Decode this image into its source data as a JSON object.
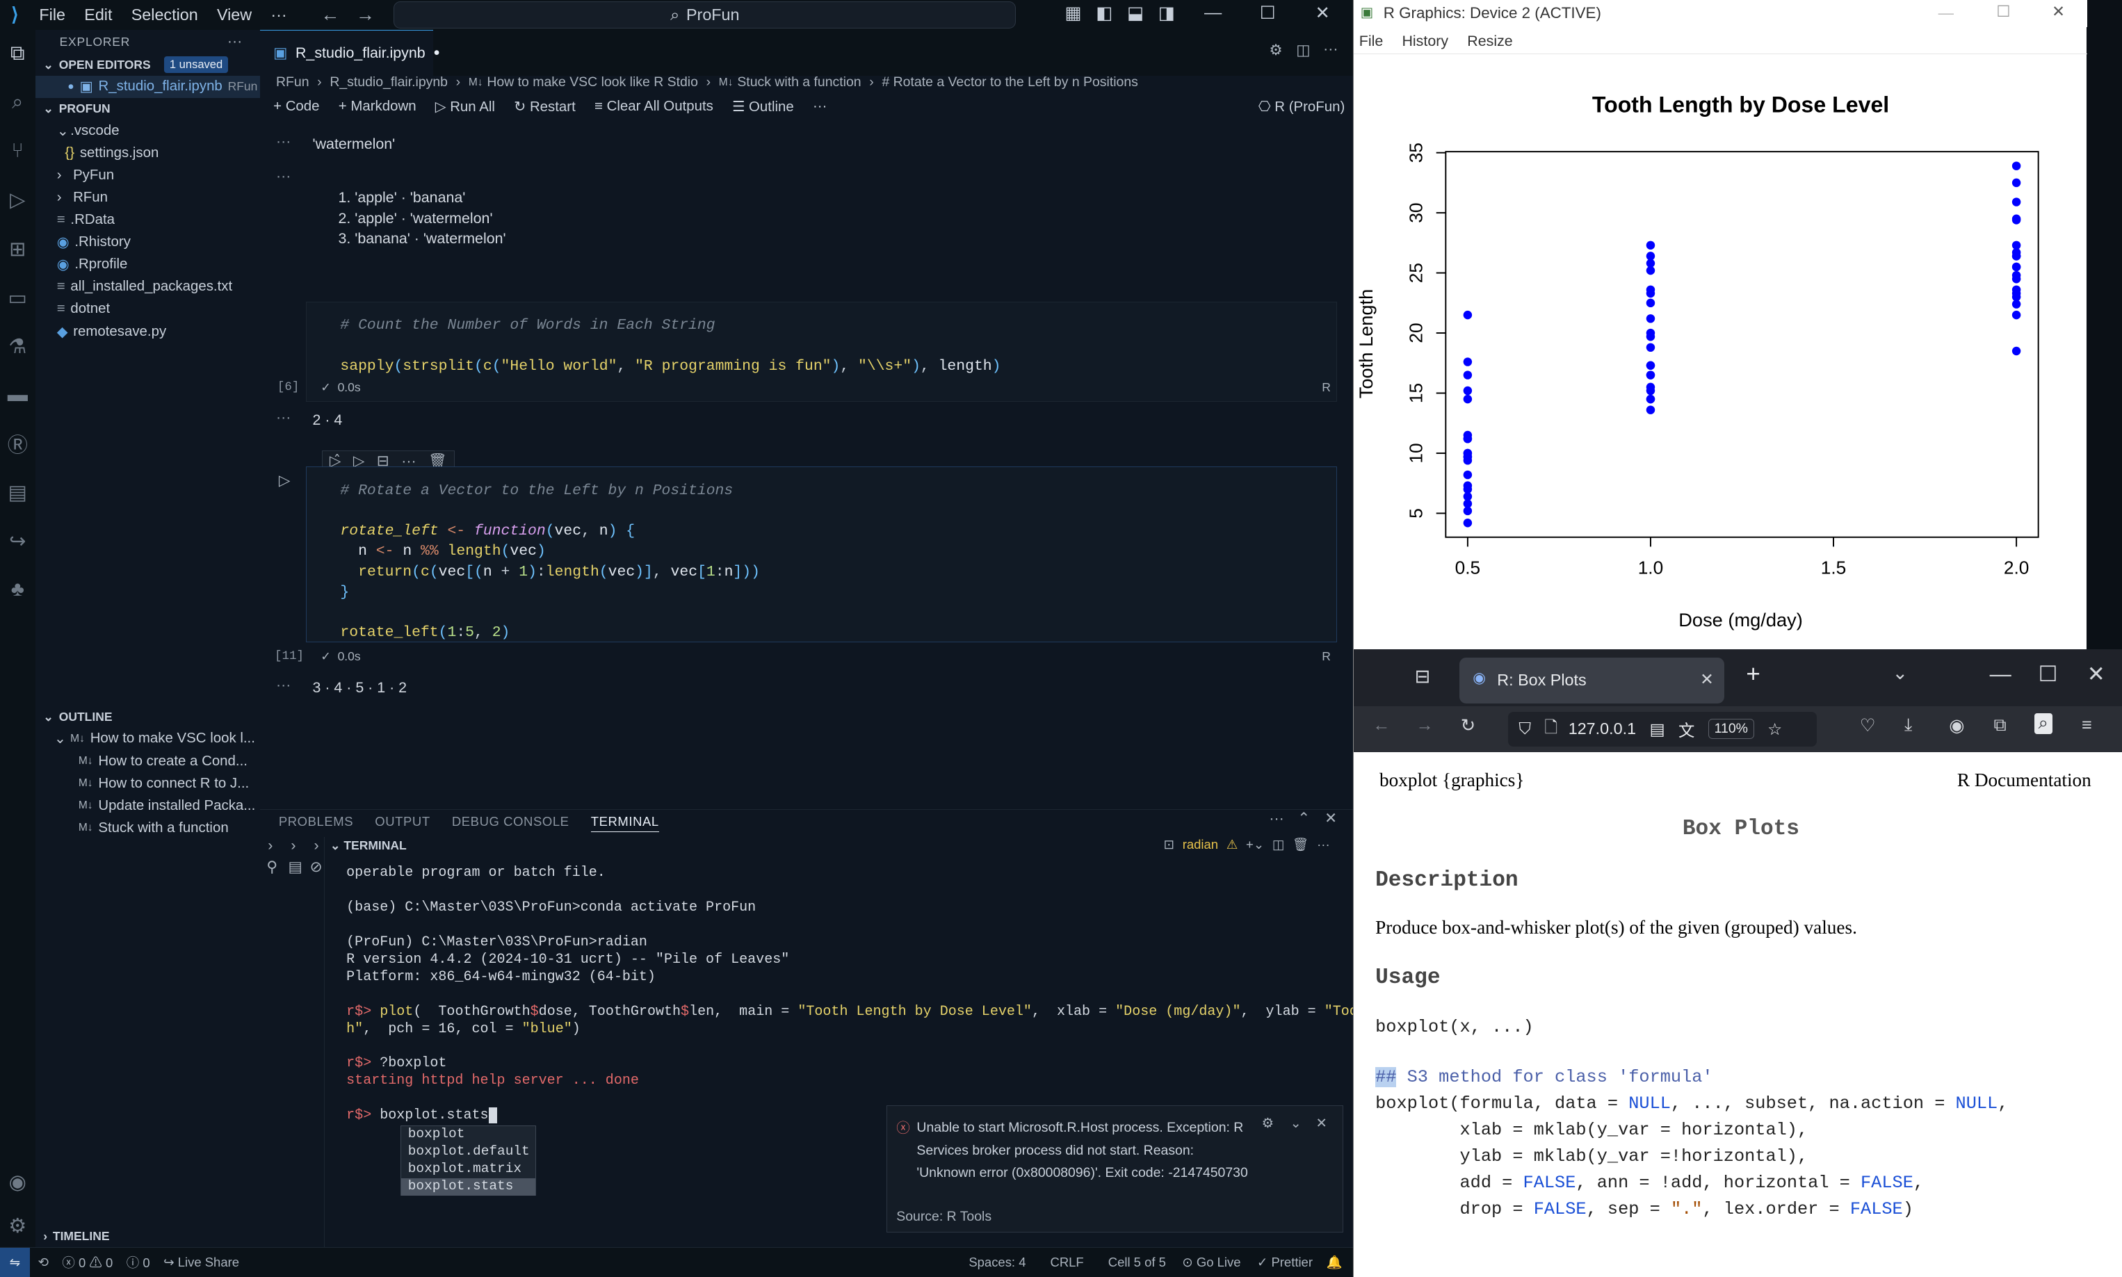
{
  "vscode": {
    "menu": [
      "File",
      "Edit",
      "Selection",
      "View",
      "···"
    ],
    "command_center": "ProFun",
    "sidebar": {
      "explorer_title": "EXPLORER",
      "open_editors": "OPEN EDITORS",
      "unsaved_badge": "1 unsaved",
      "open_file": "R_studio_flair.ipynb",
      "open_file_tag": "RFun",
      "project": "PROFUN",
      "tree": [
        ".vscode",
        "settings.json",
        "PyFun",
        "RFun",
        ".RData",
        ".Rhistory",
        ".Rprofile",
        "all_installed_packages.txt",
        "dotnet",
        "remotesave.py"
      ],
      "outline_title": "OUTLINE",
      "outline": [
        "How to make VSC look l...",
        "How to create a Cond...",
        "How to connect R to J...",
        "Update installed Packa...",
        "Stuck with a function"
      ],
      "timeline": "TIMELINE"
    },
    "tab_label": "R_studio_flair.ipynb",
    "breadcrumb": [
      "RFun",
      "R_studio_flair.ipynb",
      "How to make VSC look like R Stdio",
      "Stuck with a function",
      "# Rotate a Vector to the Left by n Positions"
    ],
    "toolbar": {
      "code": "Code",
      "markdown": "Markdown",
      "run_all": "Run All",
      "restart": "Restart",
      "clear": "Clear All Outputs",
      "outline": "Outline",
      "kernel": "R (ProFun)"
    },
    "outputs": {
      "watermelon": "'watermelon'",
      "list": [
        "'apple' · 'banana'",
        "'apple' · 'watermelon'",
        "'banana' · 'watermelon'"
      ],
      "words": "2 · 4",
      "rotate": "3 · 4 · 5 · 1 · 2"
    },
    "cell6": {
      "comment": "# Count the Number of Words in Each String",
      "counter": "[6]",
      "time": "0.0s",
      "lang": "R"
    },
    "cell11": {
      "comment": "# Rotate a Vector to the Left by n Positions",
      "counter": "[11]",
      "time": "0.0s",
      "lang": "R"
    },
    "panel_tabs": [
      "PROBLEMS",
      "OUTPUT",
      "DEBUG CONSOLE",
      "TERMINAL"
    ],
    "terminal_label": "TERMINAL",
    "terminal_shell": "radian",
    "autocomplete": [
      "boxplot",
      "boxplot.default",
      "boxplot.matrix",
      "boxplot.stats"
    ],
    "toast": {
      "message": "Unable to start Microsoft.R.Host process. Exception: R Services broker process did not start. Reason: 'Unknown error (0x80008096)'. Exit code: -2147450730",
      "source": "Source: R Tools"
    },
    "status": {
      "errors": "0",
      "warnings": "0",
      "info": "0",
      "live_share": "Live Share",
      "spaces": "Spaces: 4",
      "eol": "CRLF",
      "cell": "Cell 5 of 5",
      "golive": "Go Live",
      "prettier": "Prettier"
    }
  },
  "rgraphics": {
    "window_title": "R Graphics: Device 2 (ACTIVE)",
    "menu": [
      "File",
      "History",
      "Resize"
    ]
  },
  "chart_data": {
    "type": "scatter",
    "title": "Tooth Length by Dose Level",
    "xlabel": "Dose (mg/day)",
    "ylabel": "Tooth Length",
    "xlim": [
      0.5,
      2.0
    ],
    "ylim": [
      4.2,
      33.9
    ],
    "xticks": [
      "0.5",
      "1.0",
      "1.5",
      "2.0"
    ],
    "yticks": [
      "5",
      "10",
      "15",
      "20",
      "25",
      "30",
      "35"
    ],
    "color": "#0000ff",
    "x": [
      0.5,
      0.5,
      0.5,
      0.5,
      0.5,
      0.5,
      0.5,
      0.5,
      0.5,
      0.5,
      0.5,
      0.5,
      0.5,
      0.5,
      0.5,
      0.5,
      0.5,
      0.5,
      0.5,
      0.5,
      1.0,
      1.0,
      1.0,
      1.0,
      1.0,
      1.0,
      1.0,
      1.0,
      1.0,
      1.0,
      1.0,
      1.0,
      1.0,
      1.0,
      1.0,
      1.0,
      1.0,
      1.0,
      1.0,
      1.0,
      2.0,
      2.0,
      2.0,
      2.0,
      2.0,
      2.0,
      2.0,
      2.0,
      2.0,
      2.0,
      2.0,
      2.0,
      2.0,
      2.0,
      2.0,
      2.0,
      2.0,
      2.0,
      2.0,
      2.0
    ],
    "y": [
      4.2,
      11.5,
      7.3,
      5.8,
      6.4,
      10,
      11.2,
      11.2,
      5.2,
      7,
      15.2,
      21.5,
      17.6,
      9.7,
      14.5,
      10,
      8.2,
      9.4,
      16.5,
      9.7,
      16.5,
      16.5,
      15.2,
      17.3,
      22.5,
      17.3,
      13.6,
      14.5,
      18.8,
      15.5,
      19.7,
      23.3,
      23.6,
      26.4,
      20,
      25.2,
      25.8,
      21.2,
      14.5,
      27.3,
      23.6,
      18.5,
      33.9,
      25.5,
      26.4,
      32.5,
      26.7,
      21.5,
      23.3,
      29.5,
      25.5,
      26.4,
      22.4,
      24.5,
      24.8,
      30.9,
      26.4,
      27.3,
      29.4,
      23
    ]
  },
  "browser": {
    "tab_title": "R: Box Plots",
    "url": "127.0.0.1",
    "zoom": "110%",
    "doc": {
      "pkg": "boxplot {graphics}",
      "rdoc": "R Documentation",
      "title": "Box Plots",
      "description_h": "Description",
      "description": "Produce box-and-whisker plot(s) of the given (grouped) values.",
      "usage_h": "Usage",
      "usage": "boxplot(x, ...)"
    }
  }
}
